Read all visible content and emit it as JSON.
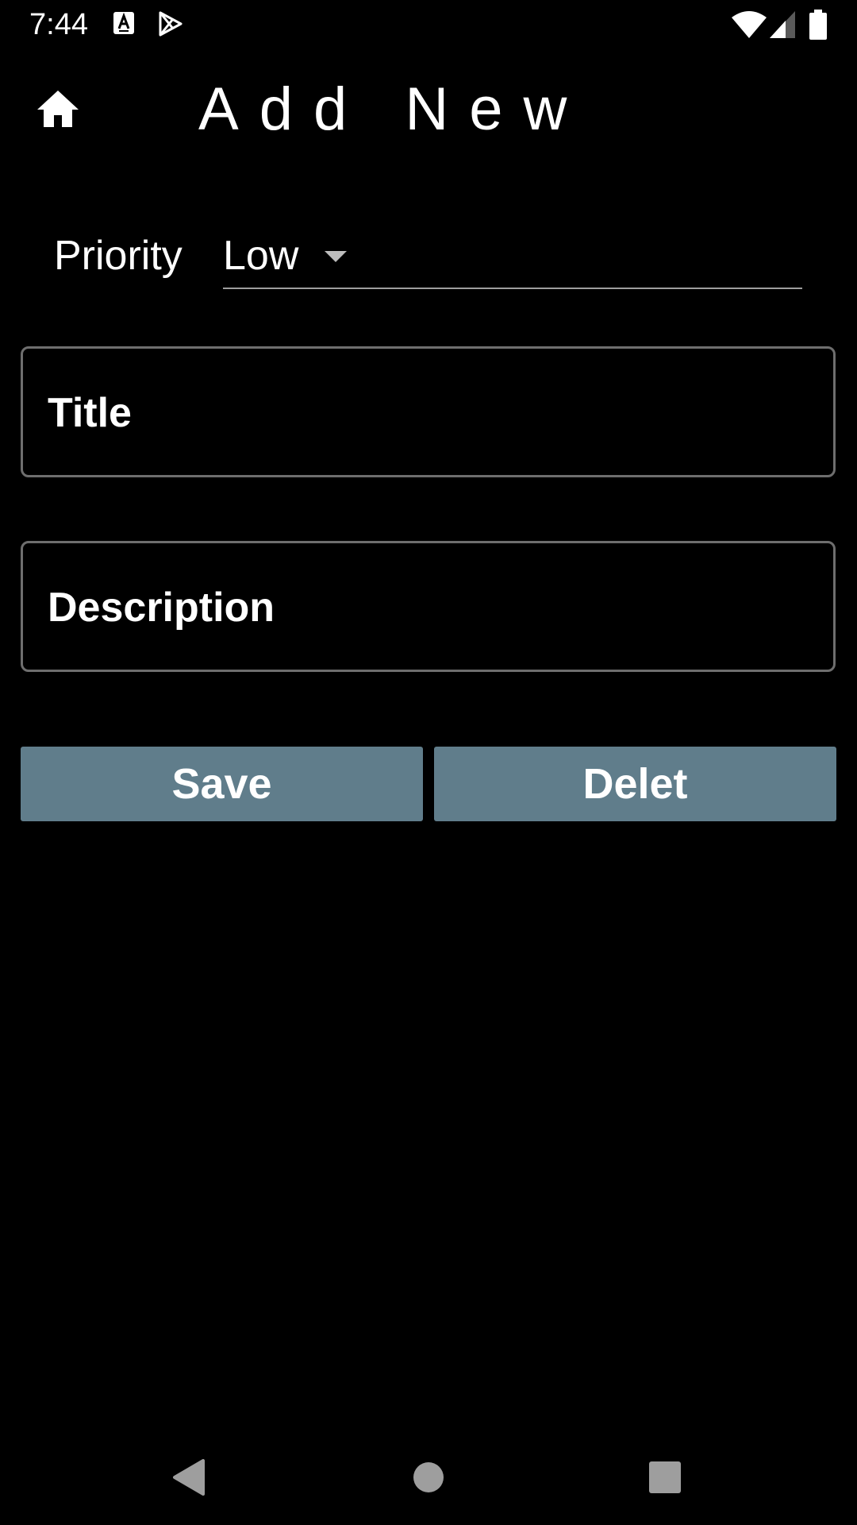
{
  "status_bar": {
    "time": "7:44",
    "icons": [
      "font-a-icon",
      "play-store-icon",
      "wifi-icon",
      "signal-icon",
      "battery-icon"
    ]
  },
  "header": {
    "title": "Add New",
    "home_icon": "home-icon"
  },
  "form": {
    "priority_label": "Priority",
    "priority_value": "Low",
    "title_placeholder": "Title",
    "description_placeholder": "Description"
  },
  "actions": {
    "save_label": "Save",
    "delete_label": "Delet"
  },
  "nav_bar": {
    "icons": [
      "back-icon",
      "home-circle-icon",
      "recents-icon"
    ]
  },
  "colors": {
    "background": "#000000",
    "button": "#607d8b",
    "field_border": "#6e6e6e",
    "nav_icon": "#9e9e9e"
  }
}
